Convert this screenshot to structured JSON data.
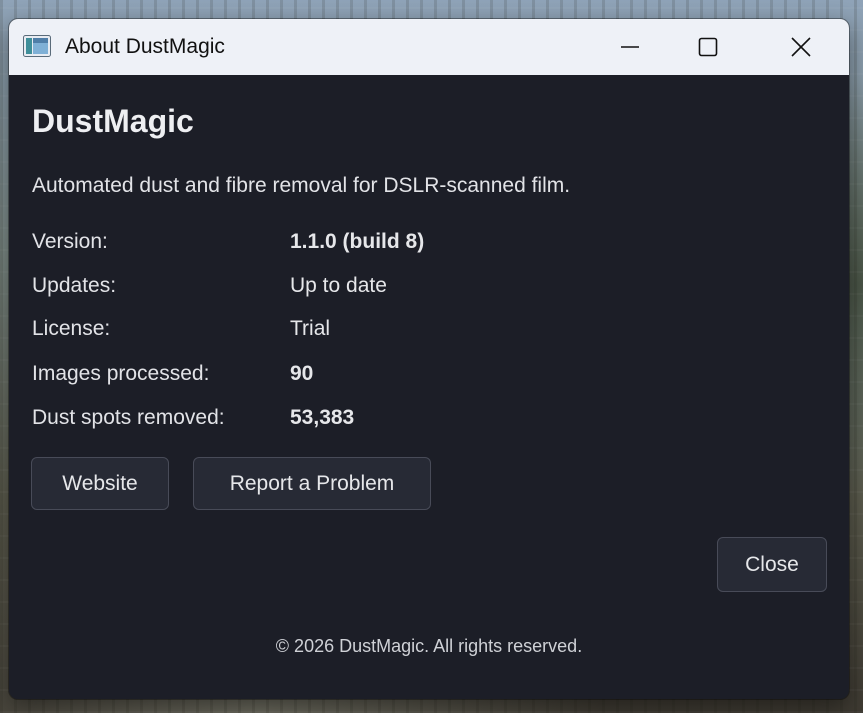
{
  "window": {
    "title": "About DustMagic"
  },
  "about": {
    "app_name": "DustMagic",
    "description": "Automated dust and fibre removal for DSLR-scanned film.",
    "rows": [
      {
        "label": "Version:",
        "value": "1.1.0 (build 8)",
        "bold": true
      },
      {
        "label": "Updates:",
        "value": "Up to date",
        "bold": false
      },
      {
        "label": "License:",
        "value": "Trial",
        "bold": false
      },
      {
        "label": "Images processed:",
        "value": "90",
        "bold": true
      },
      {
        "label": "Dust spots removed:",
        "value": "53,383",
        "bold": true
      }
    ]
  },
  "buttons": {
    "website": "Website",
    "report": "Report a Problem",
    "close": "Close"
  },
  "footer": {
    "copyright": "© 2026 DustMagic. All rights reserved."
  },
  "icons": {
    "app": "app-window-icon",
    "minimize": "minimize-icon",
    "maximize": "maximize-icon",
    "close": "close-icon"
  }
}
